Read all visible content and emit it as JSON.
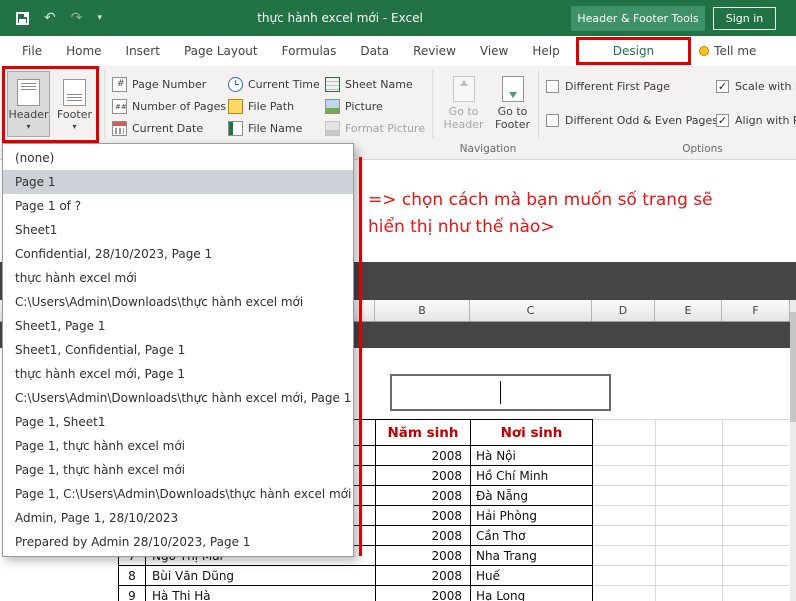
{
  "colors": {
    "excel_green": "#217346",
    "annotation_red": "#e10000",
    "table_header_red": "#c00000"
  },
  "titlebar": {
    "title": "thực hành excel mới - Excel",
    "context_tool_label": "Header & Footer Tools",
    "sign_in_label": "Sign in"
  },
  "tabs": {
    "file": "File",
    "home": "Home",
    "insert": "Insert",
    "page_layout": "Page Layout",
    "formulas": "Formulas",
    "data": "Data",
    "review": "Review",
    "view": "View",
    "help": "Help",
    "design": "Design",
    "tell_me": "Tell me"
  },
  "ribbon": {
    "header_label": "Header",
    "footer_label": "Footer",
    "elements": {
      "page_number": "Page Number",
      "number_of_pages": "Number of Pages",
      "current_date": "Current Date",
      "current_time": "Current Time",
      "file_path": "File Path",
      "file_name": "File Name",
      "sheet_name": "Sheet Name",
      "picture": "Picture",
      "format_picture": "Format Picture"
    },
    "navigation": {
      "group_label": "Navigation",
      "goto_header": "Go to Header",
      "goto_footer": "Go to Footer"
    },
    "options": {
      "group_label": "Options",
      "items": [
        {
          "label": "Different First Page",
          "mark": ""
        },
        {
          "label": "Different Odd & Even Pages",
          "mark": ""
        },
        {
          "label": "Scale with D",
          "mark": "✓"
        },
        {
          "label": "Align with P",
          "mark": "✓"
        }
      ]
    }
  },
  "dropdown": {
    "items": [
      "(none)",
      "Page 1",
      "Page 1 of ?",
      "Sheet1",
      "Confidential, 28/10/2023, Page 1",
      "thực hành excel mới",
      "C:\\Users\\Admin\\Downloads\\thực hành excel mới",
      "Sheet1, Page 1",
      "Sheet1, Confidential, Page 1",
      "thực hành excel mới, Page 1",
      "C:\\Users\\Admin\\Downloads\\thực hành excel mới, Page 1",
      "Page 1, Sheet1",
      "Page 1, thực hành excel mới",
      "Page 1, thực hành excel mới",
      "Page 1, C:\\Users\\Admin\\Downloads\\thực hành excel mới",
      "Admin, Page 1, 28/10/2023",
      "Prepared by Admin 28/10/2023, Page 1"
    ]
  },
  "annotation": {
    "line1": "=> chọn cách mà bạn muốn số trang sẽ",
    "line2": "hiển thị như thế nào>"
  },
  "sheet": {
    "col_letters": [
      "B",
      "C",
      "D",
      "E",
      "F"
    ],
    "table": {
      "header_year": "Năm sinh",
      "header_city": "Nơi sinh",
      "rows": [
        {
          "stt": "",
          "name": "",
          "year": "2008",
          "city": "Hà Nội"
        },
        {
          "stt": "",
          "name": "",
          "year": "2008",
          "city": "Hồ Chí Minh"
        },
        {
          "stt": "",
          "name": "",
          "year": "2008",
          "city": "Đà Nẵng"
        },
        {
          "stt": "",
          "name": "",
          "year": "2008",
          "city": "Hải Phòng"
        },
        {
          "stt": "",
          "name": "",
          "year": "2008",
          "city": "Cần Thơ"
        },
        {
          "stt": "7",
          "name": "Ngô Thị Mai",
          "year": "2008",
          "city": "Nha Trang"
        },
        {
          "stt": "8",
          "name": "Bùi Văn Dũng",
          "year": "2008",
          "city": "Huế"
        },
        {
          "stt": "9",
          "name": "Hà Thị Hà",
          "year": "2008",
          "city": "Hạ Long"
        }
      ]
    }
  }
}
